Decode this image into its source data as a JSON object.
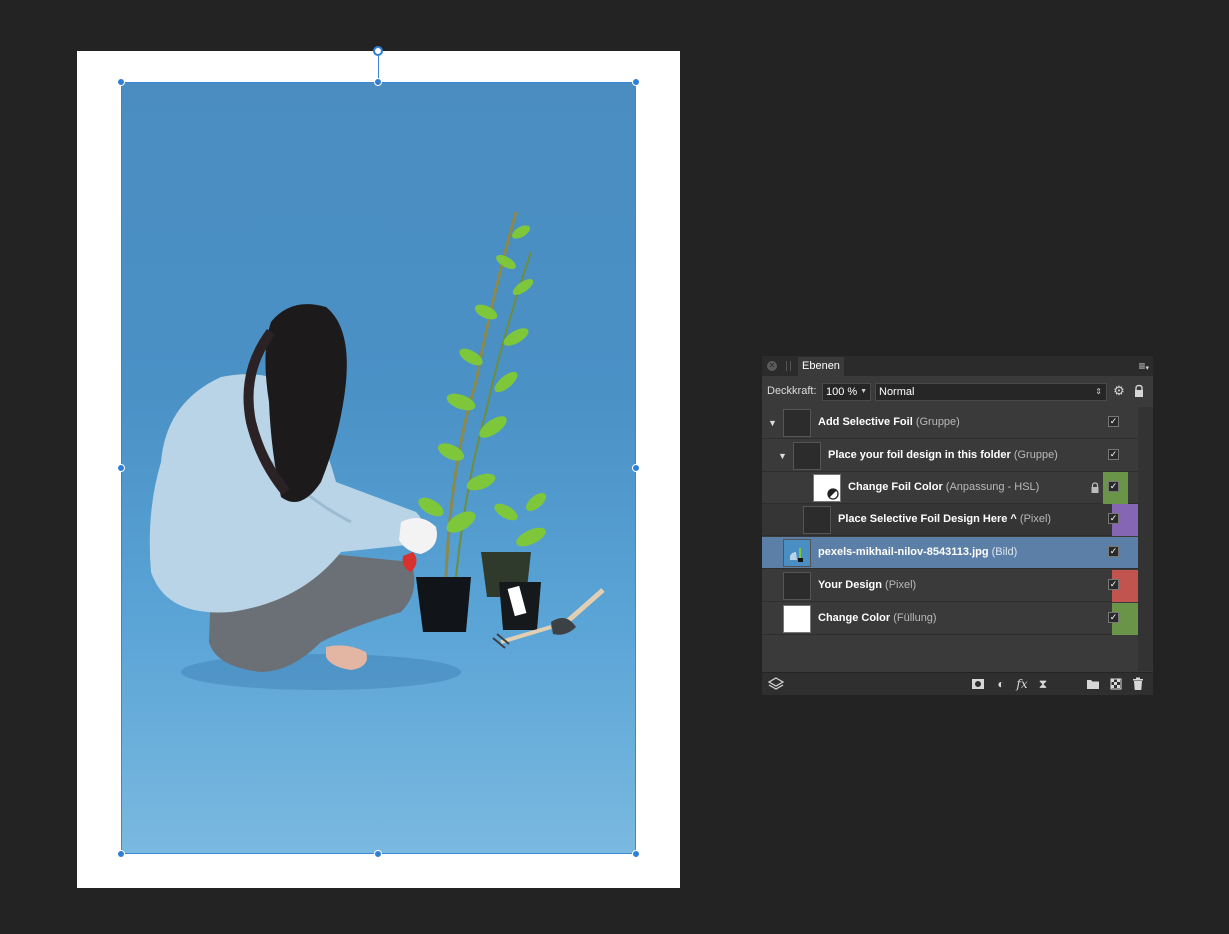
{
  "panel": {
    "tab_label": "Ebenen",
    "opacity_label": "Deckkraft:",
    "opacity_value": "100 %",
    "blend_mode": "Normal"
  },
  "layers": [
    {
      "name": "Add Selective Foil",
      "type": "(Gruppe)",
      "tag_color": ""
    },
    {
      "name": "Place your foil design in this folder",
      "type": "(Gruppe)",
      "tag_color": ""
    },
    {
      "name": "Change Foil Color",
      "type": "(Anpassung - HSL)",
      "tag_color": "#6a9448"
    },
    {
      "name": "Place Selective Foil Design Here ^",
      "type": "(Pixel)",
      "tag_color": "#8566b5"
    },
    {
      "name": "pexels-mikhail-nilov-8543113.jpg",
      "type": "(Bild)",
      "tag_color": ""
    },
    {
      "name": "Your Design",
      "type": "(Pixel)",
      "tag_color": "#c2544f"
    },
    {
      "name": "Change Color",
      "type": "(Füllung)",
      "tag_color": "#6a9448"
    }
  ],
  "icons": {
    "close": "close-icon",
    "menu": "panel-menu-icon",
    "gear": "gear-icon",
    "lock": "lock-icon",
    "check": "✓"
  },
  "colors": {
    "selection": "#3a86d6",
    "selected_row": "#5b7fa6",
    "panel_bg": "#3a3a3a",
    "workspace_bg": "#232323"
  }
}
